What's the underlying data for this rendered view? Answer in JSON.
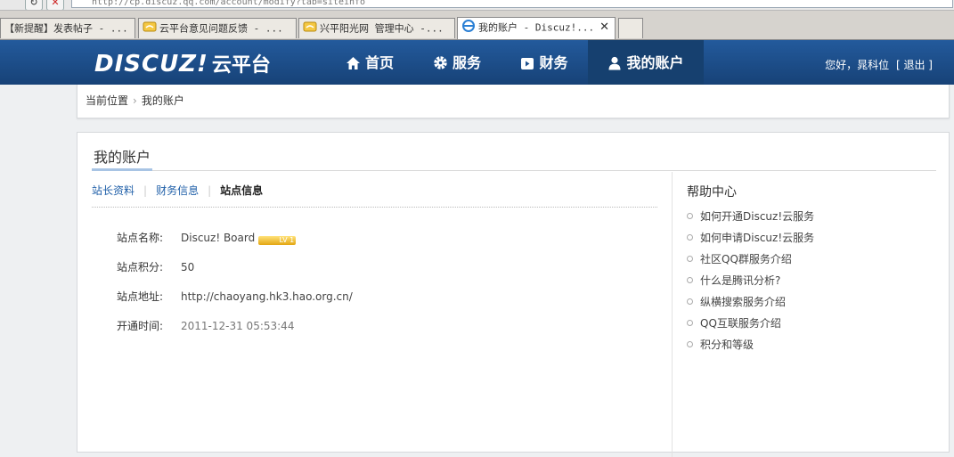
{
  "browser": {
    "url": "http://cp.discuz.qq.com/account/modify?tab=siteinfo",
    "tabs": [
      {
        "label": "【新提醒】发表帖子 - ..."
      },
      {
        "label": "云平台意见问题反馈 - ..."
      },
      {
        "label": "兴平阳光网 管理中心 -..."
      },
      {
        "label": "我的账户 - Discuz!..."
      }
    ],
    "close_glyph": "✕"
  },
  "header": {
    "logo_text": "DISCUZ!",
    "logo_cn": "云平台",
    "nav": [
      {
        "label": "首页",
        "icon": "home-icon"
      },
      {
        "label": "服务",
        "icon": "gear-icon"
      },
      {
        "label": "财务",
        "icon": "wallet-icon"
      },
      {
        "label": "我的账户",
        "icon": "user-icon"
      }
    ],
    "greeting": "您好，晁科位",
    "logout": "[ 退出 ]"
  },
  "breadcrumb": {
    "current_label": "当前位置",
    "separator": "›",
    "page": "我的账户"
  },
  "main": {
    "title": "我的账户",
    "subtabs": [
      "站长资料",
      "财务信息",
      "站点信息"
    ],
    "active_subtab": 2,
    "fields": [
      {
        "label": "站点名称:",
        "value": "Discuz! Board",
        "badge": "LV 1"
      },
      {
        "label": "站点积分:",
        "value": "50"
      },
      {
        "label": "站点地址:",
        "value": "http://chaoyang.hk3.hao.org.cn/"
      },
      {
        "label": "开通时间:",
        "value": "2011-12-31 05:53:44"
      }
    ]
  },
  "help": {
    "title": "帮助中心",
    "items": [
      "如何开通Discuz!云服务",
      "如何申请Discuz!云服务",
      "社区QQ群服务介绍",
      "什么是腾讯分析?",
      "纵横搜索服务介绍",
      "QQ互联服务介绍",
      "积分和等级"
    ]
  },
  "colors": {
    "header_bg": "#1b4c88",
    "active_nav": "#16406f",
    "link": "#1f5fa8"
  }
}
